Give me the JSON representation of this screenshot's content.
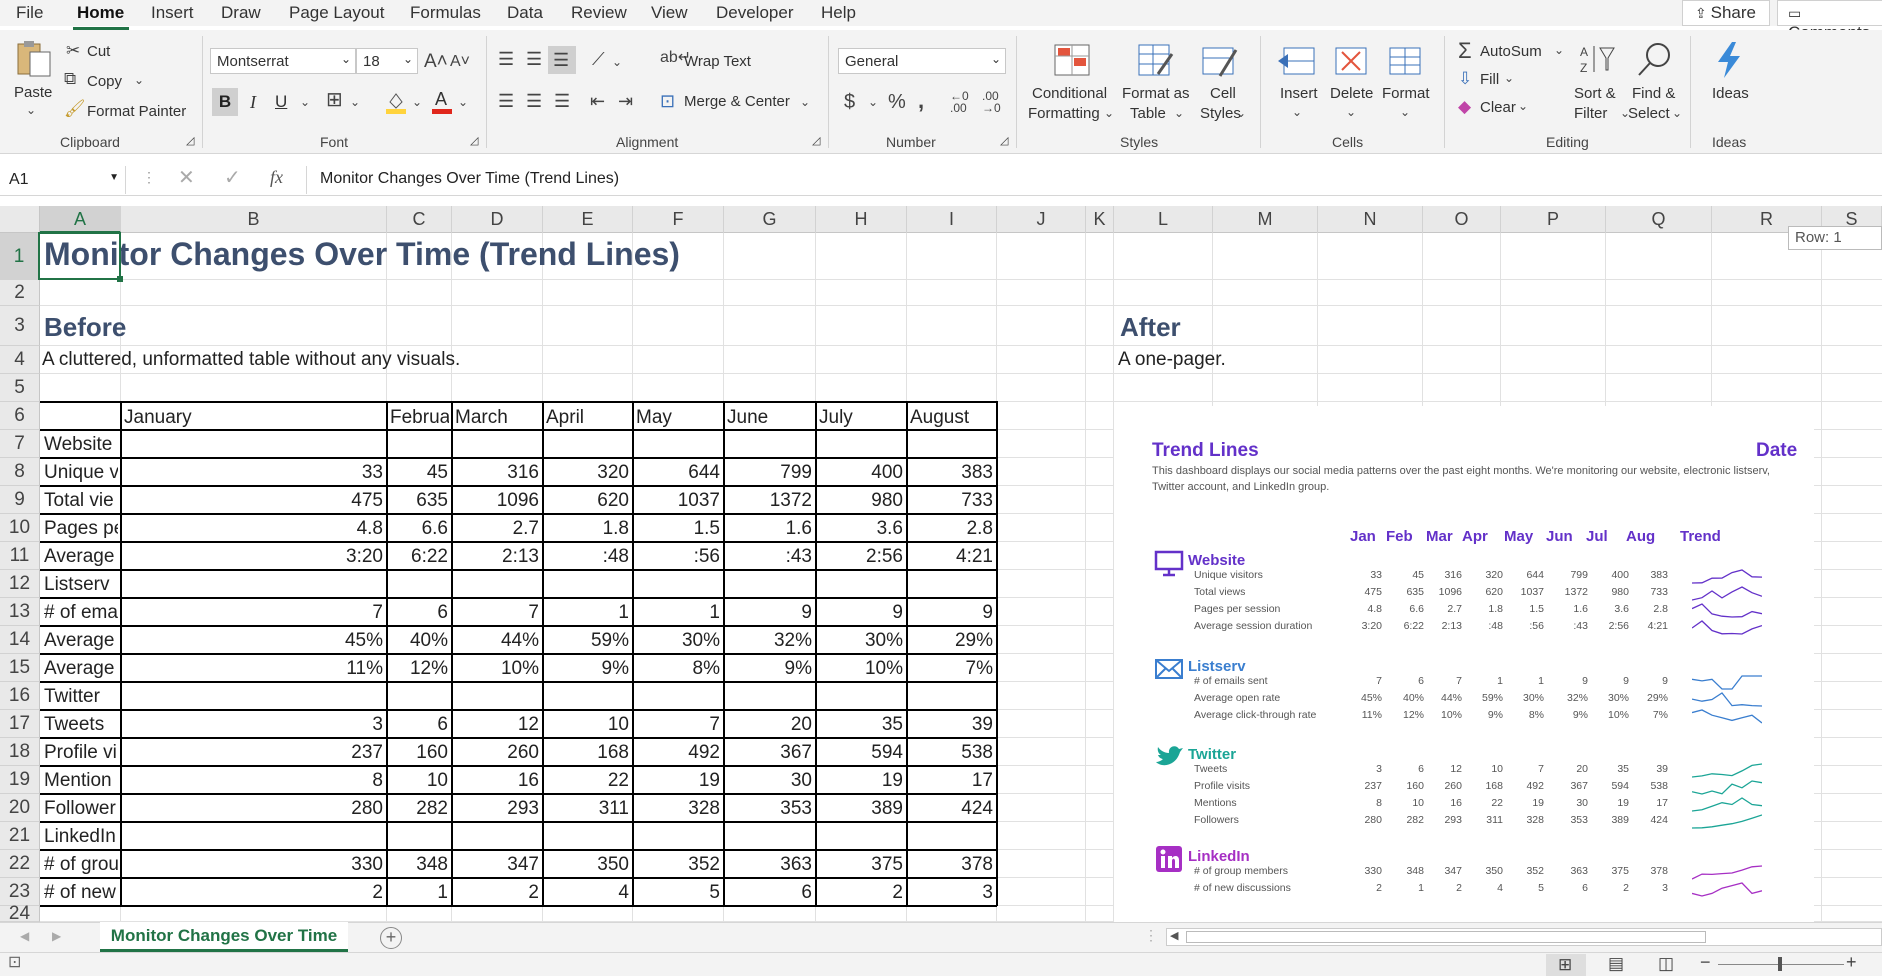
{
  "menu": {
    "items": [
      "File",
      "Home",
      "Insert",
      "Draw",
      "Page Layout",
      "Formulas",
      "Data",
      "Review",
      "View",
      "Developer",
      "Help"
    ],
    "share": "Share",
    "comments": "Comments"
  },
  "ribbon": {
    "clipboard": {
      "paste": "Paste",
      "cut": "Cut",
      "copy": "Copy",
      "format_painter": "Format Painter",
      "label": "Clipboard"
    },
    "font": {
      "font_name": "Montserrat",
      "font_size": "18",
      "bold": "B",
      "italic": "I",
      "underline": "U",
      "label": "Font"
    },
    "alignment": {
      "wrap_text": "Wrap Text",
      "merge_center": "Merge & Center",
      "label": "Alignment"
    },
    "number": {
      "format": "General",
      "label": "Number"
    },
    "styles": {
      "conditional": [
        "Conditional",
        "Formatting"
      ],
      "format_table": [
        "Format as",
        "Table"
      ],
      "cell_styles": [
        "Cell",
        "Styles"
      ],
      "label": "Styles"
    },
    "cells": {
      "insert": "Insert",
      "delete": "Delete",
      "format": "Format",
      "label": "Cells"
    },
    "editing": {
      "autosum": "AutoSum",
      "fill": "Fill",
      "clear": "Clear",
      "sort": [
        "Sort &",
        "Filter"
      ],
      "find": [
        "Find &",
        "Select"
      ],
      "label": "Editing"
    },
    "ideas": {
      "ideas": "Ideas",
      "label": "Ideas"
    }
  },
  "formula_bar": {
    "name_box": "A1",
    "fx": "fx",
    "formula": "Monitor Changes Over Time (Trend Lines)"
  },
  "columns": [
    "A",
    "B",
    "C",
    "D",
    "E",
    "F",
    "G",
    "H",
    "I",
    "J",
    "K",
    "L",
    "M",
    "N",
    "O",
    "P",
    "Q",
    "R",
    "S"
  ],
  "rows": [
    "1",
    "2",
    "3",
    "4",
    "5",
    "6",
    "7",
    "8",
    "9",
    "10",
    "11",
    "12",
    "13",
    "14",
    "15",
    "16",
    "17",
    "18",
    "19",
    "20",
    "21",
    "22",
    "23",
    "24"
  ],
  "row_tooltip": "Row: 1",
  "sheet": {
    "title": "Monitor Changes Over Time (Trend Lines)",
    "before_heading": "Before",
    "before_desc": "A cluttered, unformatted table without any visuals.",
    "after_heading": "After",
    "after_desc": "A one-pager.",
    "month_headers": [
      "January",
      "Februa",
      "March",
      "April",
      "May",
      "June",
      "July",
      "August"
    ],
    "row_labels": [
      "Website",
      "Unique v",
      "Total vie",
      "Pages pe",
      "Average",
      "Listserv",
      "# of ema",
      "Average",
      "Average",
      "Twitter",
      "Tweets",
      "Profile vi",
      "Mention",
      "Follower",
      "LinkedIn",
      "# of grou",
      "# of new"
    ],
    "values": [
      [],
      [
        "33",
        "45",
        "316",
        "320",
        "644",
        "799",
        "400",
        "383"
      ],
      [
        "475",
        "635",
        "1096",
        "620",
        "1037",
        "1372",
        "980",
        "733"
      ],
      [
        "4.8",
        "6.6",
        "2.7",
        "1.8",
        "1.5",
        "1.6",
        "3.6",
        "2.8"
      ],
      [
        "3:20",
        "6:22",
        "2:13",
        ":48",
        ":56",
        ":43",
        "2:56",
        "4:21"
      ],
      [],
      [
        "7",
        "6",
        "7",
        "1",
        "1",
        "9",
        "9",
        "9"
      ],
      [
        "45%",
        "40%",
        "44%",
        "59%",
        "30%",
        "32%",
        "30%",
        "29%"
      ],
      [
        "11%",
        "12%",
        "10%",
        "9%",
        "8%",
        "9%",
        "10%",
        "7%"
      ],
      [],
      [
        "3",
        "6",
        "12",
        "10",
        "7",
        "20",
        "35",
        "39"
      ],
      [
        "237",
        "160",
        "260",
        "168",
        "492",
        "367",
        "594",
        "538"
      ],
      [
        "8",
        "10",
        "16",
        "22",
        "19",
        "30",
        "19",
        "17"
      ],
      [
        "280",
        "282",
        "293",
        "311",
        "328",
        "353",
        "389",
        "424"
      ],
      [],
      [
        "330",
        "348",
        "347",
        "350",
        "352",
        "363",
        "375",
        "378"
      ],
      [
        "2",
        "1",
        "2",
        "4",
        "5",
        "6",
        "2",
        "3"
      ]
    ]
  },
  "dashboard": {
    "title": "Trend Lines",
    "date": "Date",
    "description_line1": "This dashboard displays our social media patterns over the past eight months. We're monitoring our website, electronic listserv,",
    "description_line2": "Twitter account, and LinkedIn group.",
    "months": [
      "Jan",
      "Feb",
      "Mar",
      "Apr",
      "May",
      "Jun",
      "Jul",
      "Aug",
      "Trend"
    ],
    "sections": [
      {
        "name": "Website",
        "icon": "monitor-icon",
        "color": "#6331c9",
        "lines": [
          {
            "label": "Unique visitors",
            "values": [
              "33",
              "45",
              "316",
              "320",
              "644",
              "799",
              "400",
              "383"
            ]
          },
          {
            "label": "Total views",
            "values": [
              "475",
              "635",
              "1096",
              "620",
              "1037",
              "1372",
              "980",
              "733"
            ]
          },
          {
            "label": "Pages per session",
            "values": [
              "4.8",
              "6.6",
              "2.7",
              "1.8",
              "1.5",
              "1.6",
              "3.6",
              "2.8"
            ]
          },
          {
            "label": "Average session duration",
            "values": [
              "3:20",
              "6:22",
              "2:13",
              ":48",
              ":56",
              ":43",
              "2:56",
              "4:21"
            ]
          }
        ]
      },
      {
        "name": "Listserv",
        "icon": "envelope-icon",
        "color": "#3a7ecf",
        "lines": [
          {
            "label": "# of emails sent",
            "values": [
              "7",
              "6",
              "7",
              "1",
              "1",
              "9",
              "9",
              "9"
            ]
          },
          {
            "label": "Average open rate",
            "values": [
              "45%",
              "40%",
              "44%",
              "59%",
              "30%",
              "32%",
              "30%",
              "29%"
            ]
          },
          {
            "label": "Average click-through rate",
            "values": [
              "11%",
              "12%",
              "10%",
              "9%",
              "8%",
              "9%",
              "10%",
              "7%"
            ]
          }
        ]
      },
      {
        "name": "Twitter",
        "icon": "bird-icon",
        "color": "#1ba596",
        "lines": [
          {
            "label": "Tweets",
            "values": [
              "3",
              "6",
              "12",
              "10",
              "7",
              "20",
              "35",
              "39"
            ]
          },
          {
            "label": "Profile visits",
            "values": [
              "237",
              "160",
              "260",
              "168",
              "492",
              "367",
              "594",
              "538"
            ]
          },
          {
            "label": "Mentions",
            "values": [
              "8",
              "10",
              "16",
              "22",
              "19",
              "30",
              "19",
              "17"
            ]
          },
          {
            "label": "Followers",
            "values": [
              "280",
              "282",
              "293",
              "311",
              "328",
              "353",
              "389",
              "424"
            ]
          }
        ]
      },
      {
        "name": "LinkedIn",
        "icon": "linkedin-icon",
        "color": "#a62fc4",
        "lines": [
          {
            "label": "# of group members",
            "values": [
              "330",
              "348",
              "347",
              "350",
              "352",
              "363",
              "375",
              "378"
            ]
          },
          {
            "label": "# of new discussions",
            "values": [
              "2",
              "1",
              "2",
              "4",
              "5",
              "6",
              "2",
              "3"
            ]
          }
        ]
      }
    ]
  },
  "tabs": {
    "active": "Monitor Changes Over Time"
  },
  "colors": {
    "accent": "#217346",
    "dash_purple": "#6331c9",
    "title_navy": "#3d4f6e"
  }
}
